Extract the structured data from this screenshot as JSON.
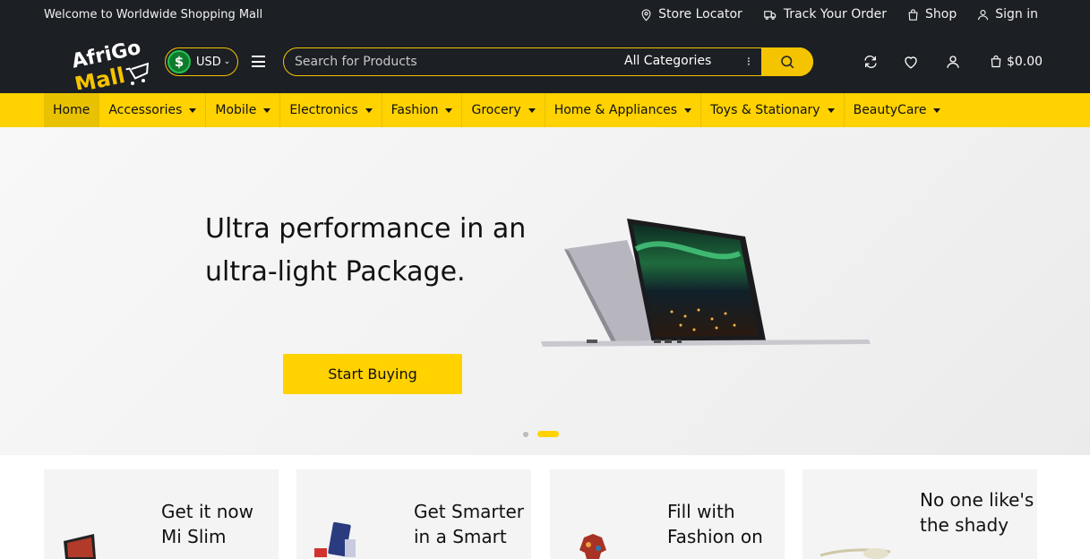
{
  "topbar": {
    "welcome": "Welcome to Worldwide Shopping Mall",
    "links": [
      {
        "label": "Store Locator",
        "icon": "map-pin-icon"
      },
      {
        "label": "Track Your Order",
        "icon": "truck-icon"
      },
      {
        "label": "Shop",
        "icon": "shopping-bag-icon"
      },
      {
        "label": "Sign in",
        "icon": "user-icon"
      }
    ]
  },
  "header": {
    "logo_line1": "AfriGo",
    "logo_line2": "Mall",
    "currency": "USD",
    "search_placeholder": "Search for Products",
    "category": "All Categories",
    "cart_total": "$0.00"
  },
  "nav": {
    "items": [
      "Home",
      "Accessories",
      "Mobile",
      "Electronics",
      "Fashion",
      "Grocery",
      "Home & Appliances",
      "Toys & Stationary",
      "BeautyCare"
    ]
  },
  "hero": {
    "headline": "Ultra performance in an ultra-light Package.",
    "cta": "Start Buying"
  },
  "promos": [
    {
      "text": "Get it now Mi Slim"
    },
    {
      "text": "Get Smarter in a Smart"
    },
    {
      "text": "Fill with Fashion on"
    },
    {
      "text": "No one like's the shady"
    }
  ],
  "colors": {
    "accent": "#ffd200",
    "dark": "#1c1f23"
  }
}
